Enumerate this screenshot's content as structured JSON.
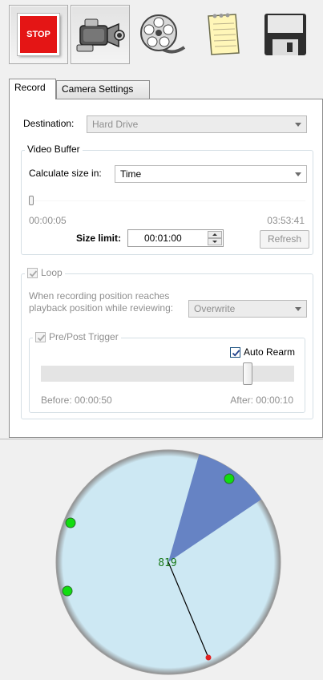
{
  "toolbar": {
    "stop_label": "STOP",
    "buttons": [
      {
        "icon": "stop-icon",
        "pressed": true
      },
      {
        "icon": "camera-icon",
        "pressed": true
      },
      {
        "icon": "film-reel-icon",
        "pressed": false
      },
      {
        "icon": "notepad-icon",
        "pressed": false
      },
      {
        "icon": "floppy-disk-icon",
        "pressed": false
      }
    ]
  },
  "tabs": [
    {
      "label": "Record",
      "active": true
    },
    {
      "label": "Camera Settings",
      "active": false
    }
  ],
  "record": {
    "destination_label": "Destination:",
    "destination_value": "Hard Drive",
    "video_buffer": {
      "title": "Video Buffer",
      "calc_label": "Calculate size in:",
      "calc_value": "Time",
      "slider_min": "00:00:05",
      "slider_max": "03:53:41",
      "slider_fraction": 0.0,
      "size_limit_label": "Size limit:",
      "size_limit_value": "00:01:00",
      "refresh_label": "Refresh"
    },
    "loop": {
      "title": "Loop",
      "checked": true,
      "reach_text_line1": "When recording position reaches",
      "reach_text_line2": "playback position while reviewing:",
      "reach_value": "Overwrite",
      "pre_post": {
        "title": "Pre/Post Trigger",
        "checked": true,
        "auto_rearm_label": "Auto Rearm",
        "auto_rearm_checked": true,
        "slider_fraction": 0.83,
        "before_text": "Before: 00:00:50",
        "after_text": "After: 00:00:10"
      }
    }
  },
  "clock": {
    "value_label": "819",
    "fill_color": "#cde8f3",
    "wedge_color": "#6683c4",
    "marker_color": "#11dd11",
    "hand_tip_color": "#e02020"
  }
}
